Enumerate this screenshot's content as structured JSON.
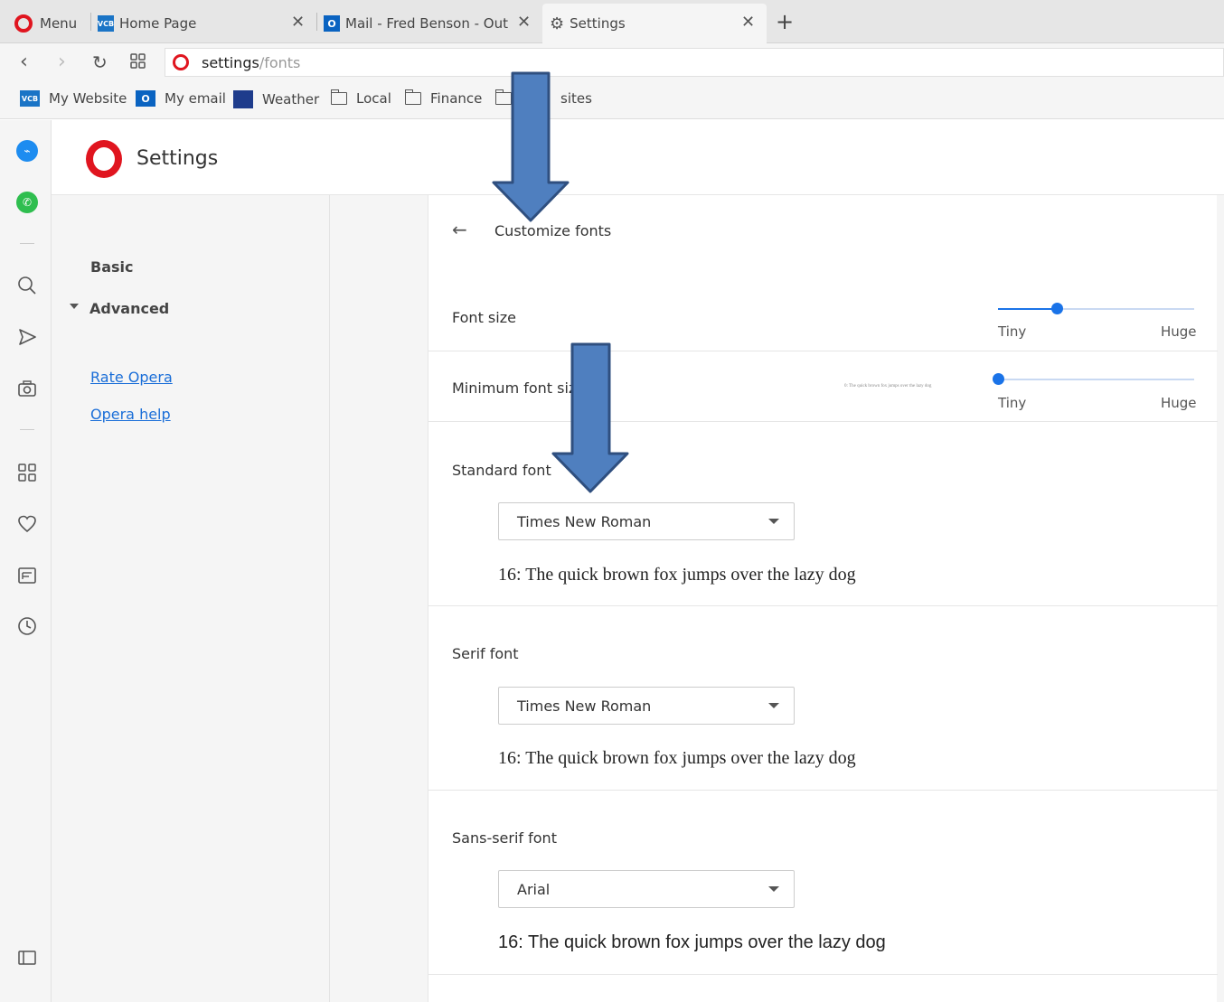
{
  "tabs": {
    "menu_label": "Menu",
    "home_page": "Home Page",
    "mail": "Mail - Fred Benson - Outlo",
    "settings": "Settings",
    "vcb_badge": "VCB",
    "outlook_badge": "O"
  },
  "address": {
    "host": "settings",
    "path": "/fonts"
  },
  "bookmarks": [
    {
      "label": "My Website",
      "icon": "vcb-icon"
    },
    {
      "label": "My email",
      "icon": "outlook-icon"
    },
    {
      "label": "Weather",
      "icon": "weather-icon"
    },
    {
      "label": "Local",
      "icon": "folder-icon"
    },
    {
      "label": "Finance",
      "icon": "folder-icon"
    },
    {
      "label": "sites",
      "icon": "folder-icon"
    }
  ],
  "settings_title": "Settings",
  "nav": {
    "basic": "Basic",
    "advanced": "Advanced",
    "rate": "Rate Opera",
    "help": "Opera help"
  },
  "page": {
    "title": "Customize fonts",
    "font_size": {
      "label": "Font size",
      "min": "Tiny",
      "max": "Huge",
      "level": 0.3
    },
    "min_font_size": {
      "label": "Minimum font size",
      "min": "Tiny",
      "max": "Huge",
      "level": 0.0,
      "preview": "0: The quick brown fox jumps over the lazy dog"
    },
    "standard": {
      "label": "Standard font",
      "value": "Times New Roman",
      "preview": "16: The quick brown fox jumps over the lazy dog"
    },
    "serif": {
      "label": "Serif font",
      "value": "Times New Roman",
      "preview": "16: The quick brown fox jumps over the lazy dog"
    },
    "sans": {
      "label": "Sans-serif font",
      "value": "Arial",
      "preview": "16: The quick brown fox jumps over the lazy dog"
    }
  },
  "colors": {
    "accent": "#1a73e8",
    "opera_red": "#e0151f",
    "annotation_arrow": "#4f7fbf"
  }
}
